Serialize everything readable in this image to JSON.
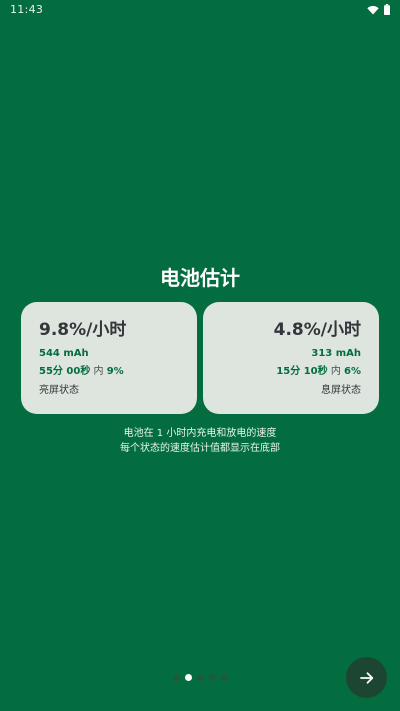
{
  "status_bar": {
    "time": "11:43",
    "icons": [
      "wifi-icon",
      "battery-icon"
    ]
  },
  "onboarding": {
    "title": "电池估计",
    "screen_on": {
      "rate": "9.8%/小时",
      "capacity": "544 mAh",
      "duration": "55分 00秒",
      "within_label": "内",
      "percent": "9%",
      "state": "亮屏状态"
    },
    "screen_off": {
      "rate": "4.8%/小时",
      "capacity": "313 mAh",
      "duration": "15分 10秒",
      "within_label": "内",
      "percent": "6%",
      "state": "息屏状态"
    },
    "description_line1": "电池在 1 小时内充电和放电的速度",
    "description_line2": "每个状态的速度估计值都显示在底部",
    "pages": {
      "total": 5,
      "current": 2
    }
  },
  "colors": {
    "background": "#046D3F",
    "card": "#DDE5DE",
    "accent": "#046D3F",
    "next_button": "#1C4631"
  }
}
